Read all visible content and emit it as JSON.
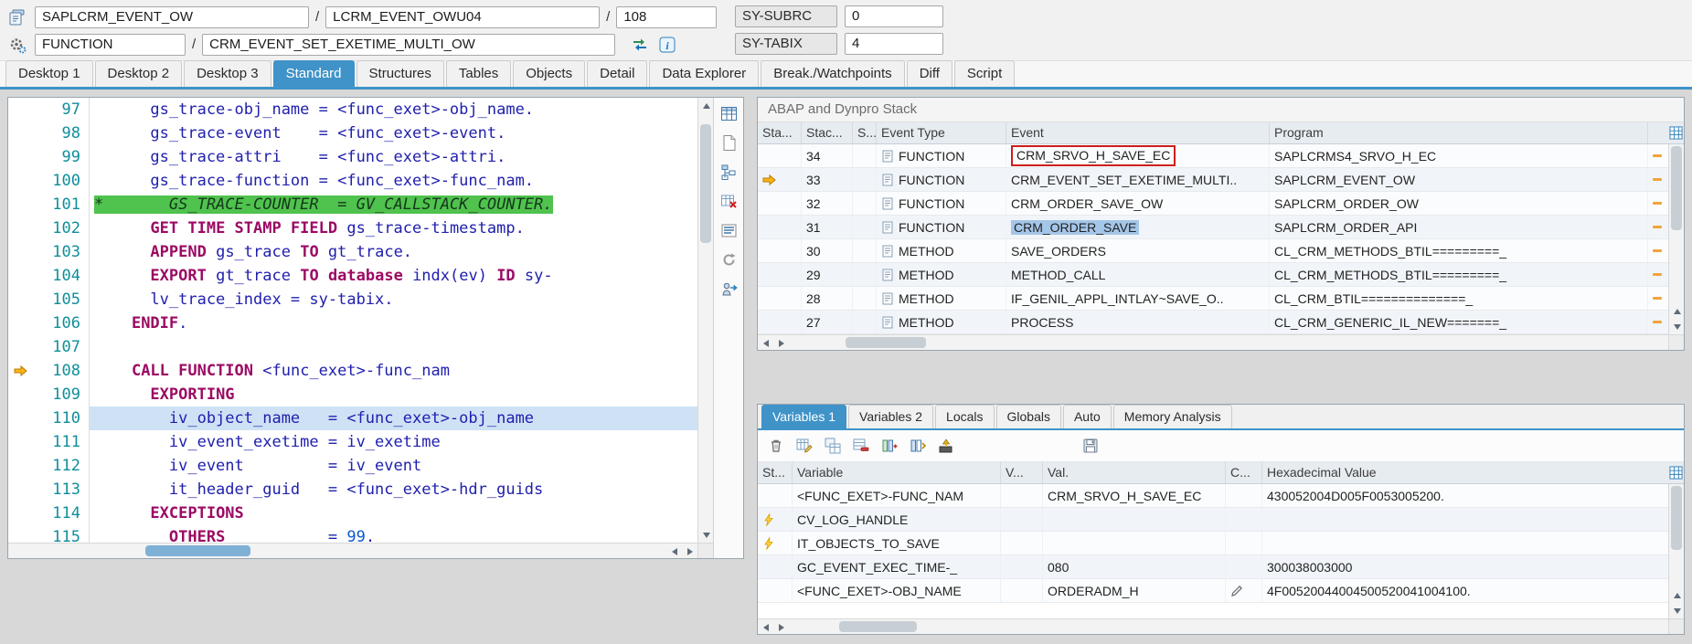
{
  "colors": {
    "accent_blue": "#3f93c8",
    "highlight_green": "#50c24e",
    "current_line_blue": "#cfe2f5",
    "annotation_red": "#cf1d1d",
    "arrow_yellow": "#fcb316",
    "keyword_color": "#9b0a63",
    "identifier_color": "#2020ae",
    "line_number_color": "#0f8e9b"
  },
  "header": {
    "row1": {
      "program": "SAPLCRM_EVENT_OW",
      "sep1": "/",
      "include": "LCRM_EVENT_OWU04",
      "sep2": "/",
      "line": "108",
      "sy_subrc_label": "SY-SUBRC",
      "sy_subrc_value": "0"
    },
    "row2": {
      "type": "FUNCTION",
      "sep": "/",
      "name": "CRM_EVENT_SET_EXETIME_MULTI_OW",
      "sy_tabix_label": "SY-TABIX",
      "sy_tabix_value": "4"
    },
    "icons": {
      "row1_left": "program-icon",
      "row2_left": "function-icon",
      "after_name": [
        "swap-icon",
        "info-icon"
      ]
    }
  },
  "tabs": {
    "active": "Standard",
    "items": [
      "Desktop 1",
      "Desktop 2",
      "Desktop 3",
      "Standard",
      "Structures",
      "Tables",
      "Objects",
      "Detail",
      "Data Explorer",
      "Break./Watchpoints",
      "Diff",
      "Script"
    ]
  },
  "editor": {
    "tools": [
      "table-icon",
      "new-page-icon",
      "hierarchy-icon",
      "delete-table-icon",
      "list-icon",
      "refresh-icon",
      "export-icon"
    ],
    "lines": [
      {
        "n": "97",
        "tokens": [
          {
            "t": "      gs_trace-obj_name = <func_exet>-obj_name.",
            "c": "id"
          }
        ]
      },
      {
        "n": "98",
        "tokens": [
          {
            "t": "      gs_trace-event    = <func_exet>-event.",
            "c": "id"
          }
        ]
      },
      {
        "n": "99",
        "tokens": [
          {
            "t": "      gs_trace-attri    = <func_exet>-attri.",
            "c": "id"
          }
        ]
      },
      {
        "n": "100",
        "tokens": [
          {
            "t": "      gs_trace-function = <func_exet>-func_nam.",
            "c": "id"
          }
        ]
      },
      {
        "n": "101",
        "hl": "green",
        "tokens": [
          {
            "t": "*       GS_TRACE-COUNTER  = GV_CALLSTACK_COUNTER.",
            "c": "cm"
          }
        ]
      },
      {
        "n": "102",
        "tokens": [
          {
            "t": "      ",
            "c": "id"
          },
          {
            "t": "GET TIME STAMP FIELD",
            "c": "kw"
          },
          {
            "t": " gs_trace-timestamp.",
            "c": "id"
          }
        ]
      },
      {
        "n": "103",
        "tokens": [
          {
            "t": "      ",
            "c": "id"
          },
          {
            "t": "APPEND",
            "c": "kw"
          },
          {
            "t": " gs_trace ",
            "c": "id"
          },
          {
            "t": "TO",
            "c": "kw"
          },
          {
            "t": " gt_trace.",
            "c": "id"
          }
        ]
      },
      {
        "n": "104",
        "tokens": [
          {
            "t": "      ",
            "c": "id"
          },
          {
            "t": "EXPORT",
            "c": "kw"
          },
          {
            "t": " gt_trace ",
            "c": "id"
          },
          {
            "t": "TO",
            "c": "kw"
          },
          {
            "t": " ",
            "c": "id"
          },
          {
            "t": "database",
            "c": "kw"
          },
          {
            "t": " indx(ev) ",
            "c": "id"
          },
          {
            "t": "ID",
            "c": "kw"
          },
          {
            "t": " sy-",
            "c": "id"
          }
        ]
      },
      {
        "n": "105",
        "tokens": [
          {
            "t": "      lv_trace_index = sy-tabix.",
            "c": "id"
          }
        ]
      },
      {
        "n": "106",
        "tokens": [
          {
            "t": "    ",
            "c": "id"
          },
          {
            "t": "ENDIF",
            "c": "kw"
          },
          {
            "t": ".",
            "c": "id"
          }
        ]
      },
      {
        "n": "107",
        "tokens": []
      },
      {
        "n": "108",
        "marker": "current",
        "tokens": [
          {
            "t": "    ",
            "c": "id"
          },
          {
            "t": "CALL FUNCTION",
            "c": "kw"
          },
          {
            "t": " <func_exet>-func_nam",
            "c": "id"
          }
        ]
      },
      {
        "n": "109",
        "tokens": [
          {
            "t": "      ",
            "c": "id"
          },
          {
            "t": "EXPORTING",
            "c": "kw"
          }
        ]
      },
      {
        "n": "110",
        "hl": "blue",
        "tokens": [
          {
            "t": "        iv_object_name   = <func_exet>-obj_name",
            "c": "id"
          }
        ]
      },
      {
        "n": "111",
        "tokens": [
          {
            "t": "        iv_event_exetime = iv_exetime",
            "c": "id"
          }
        ]
      },
      {
        "n": "112",
        "tokens": [
          {
            "t": "        iv_event         = iv_event",
            "c": "id"
          }
        ]
      },
      {
        "n": "113",
        "tokens": [
          {
            "t": "        it_header_guid   = <func_exet>-hdr_guids",
            "c": "id"
          }
        ]
      },
      {
        "n": "114",
        "tokens": [
          {
            "t": "      ",
            "c": "id"
          },
          {
            "t": "EXCEPTIONS",
            "c": "kw"
          }
        ]
      },
      {
        "n": "115",
        "tokens": [
          {
            "t": "        ",
            "c": "id"
          },
          {
            "t": "OTHERS",
            "c": "kw"
          },
          {
            "t": "           = ",
            "c": "id"
          },
          {
            "t": "99",
            "c": "num"
          },
          {
            "t": ".",
            "c": "id"
          }
        ]
      }
    ]
  },
  "stack": {
    "title": "ABAP and Dynpro Stack",
    "columns": [
      "Sta...",
      "Stac...",
      "S...",
      "Event Type",
      "Event",
      "Program"
    ],
    "rows": [
      {
        "level": "34",
        "type": "FUNCTION",
        "event": "CRM_SRVO_H_SAVE_EC",
        "program": "SAPLCRMS4_SRVO_H_EC",
        "event_annotated": true
      },
      {
        "level": "33",
        "current": true,
        "type": "FUNCTION",
        "event": "CRM_EVENT_SET_EXETIME_MULTI..",
        "program": "SAPLCRM_EVENT_OW"
      },
      {
        "level": "32",
        "type": "FUNCTION",
        "event": "CRM_ORDER_SAVE_OW",
        "program": "SAPLCRM_ORDER_OW"
      },
      {
        "level": "31",
        "type": "FUNCTION",
        "event": "CRM_ORDER_SAVE",
        "program": "SAPLCRM_ORDER_API",
        "event_selected": true
      },
      {
        "level": "30",
        "type": "METHOD",
        "event": "SAVE_ORDERS",
        "program": "CL_CRM_METHODS_BTIL=========_"
      },
      {
        "level": "29",
        "type": "METHOD",
        "event": "METHOD_CALL",
        "program": "CL_CRM_METHODS_BTIL=========_"
      },
      {
        "level": "28",
        "type": "METHOD",
        "event": "IF_GENIL_APPL_INTLAY~SAVE_O..",
        "program": "CL_CRM_BTIL==============_"
      },
      {
        "level": "27",
        "type": "METHOD",
        "event": "PROCESS",
        "program": "CL_CRM_GENERIC_IL_NEW=======_"
      }
    ]
  },
  "variables": {
    "tabs": [
      "Variables 1",
      "Variables 2",
      "Locals",
      "Globals",
      "Auto",
      "Memory Analysis"
    ],
    "active_tab": "Variables 1",
    "toolbar": [
      "trash-icon",
      "edit-table-icon",
      "copy-table-icon",
      "delete-row-icon",
      "insert-column-icon",
      "column-config-icon",
      "import-icon"
    ],
    "save_icon": "save-icon",
    "columns": [
      "St...",
      "Variable",
      "V...",
      "Val.",
      "C...",
      "Hexadecimal Value"
    ],
    "rows": [
      {
        "st": "",
        "variable": "<FUNC_EXET>-FUNC_NAM",
        "v": "",
        "val": "CRM_SRVO_H_SAVE_EC",
        "c": "",
        "hex": "430052004D005F0053005200."
      },
      {
        "st": "lightning-icon",
        "variable": "CV_LOG_HANDL​E",
        "v": "",
        "val": "",
        "c": "",
        "hex": ""
      },
      {
        "st": "lightning-icon",
        "variable": "IT_OBJECTS_TO_SAVE",
        "v": "",
        "val": "",
        "c": "",
        "hex": ""
      },
      {
        "st": "",
        "variable": "GC_EVENT_EXEC_TIME-_",
        "v": "",
        "val": "080",
        "c": "",
        "hex": "300038003000"
      },
      {
        "st": "",
        "variable": "<FUNC_EXET>-OBJ_NAME",
        "v": "",
        "val": "ORDERADM_H",
        "c": "pencil-icon",
        "hex": "4F00520044004500520041004100."
      }
    ]
  }
}
